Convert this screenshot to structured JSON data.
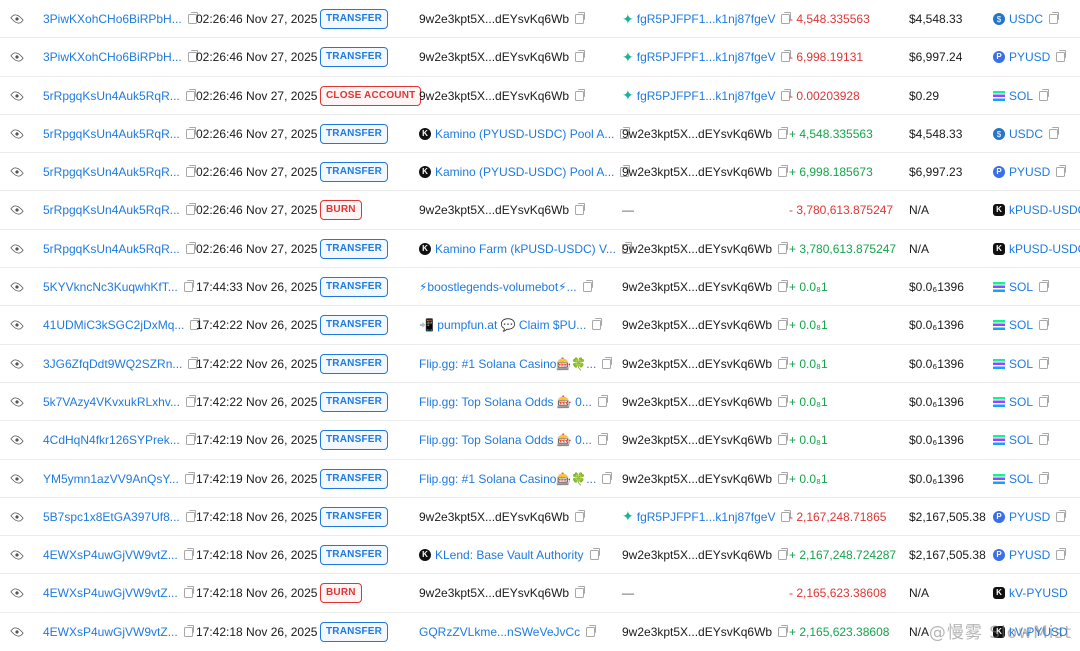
{
  "rows": [
    {
      "signature": "3PiwKXohCHo6BiRPbH...",
      "time": "02:26:46 Nov 27, 2025",
      "type": "TRANSFER",
      "from": {
        "text": "9w2e3kpt5X...dEYsvKq6Wb",
        "kind": "plain"
      },
      "to": {
        "text": "fgR5PJFPF1...k1nj87fgeV",
        "kind": "mint"
      },
      "amount": "- 4,548.335563",
      "sign": "neg",
      "value": "$4,548.33",
      "token": "USDC",
      "token_icon": "usdc"
    },
    {
      "signature": "3PiwKXohCHo6BiRPbH...",
      "time": "02:26:46 Nov 27, 2025",
      "type": "TRANSFER",
      "from": {
        "text": "9w2e3kpt5X...dEYsvKq6Wb",
        "kind": "plain"
      },
      "to": {
        "text": "fgR5PJFPF1...k1nj87fgeV",
        "kind": "mint"
      },
      "amount": "- 6,998.19131",
      "sign": "neg",
      "value": "$6,997.24",
      "token": "PYUSD",
      "token_icon": "pyusd"
    },
    {
      "signature": "5rRpgqKsUn4Auk5RqR...",
      "time": "02:26:46 Nov 27, 2025",
      "type": "CLOSE ACCOUNT",
      "from": {
        "text": "9w2e3kpt5X...dEYsvKq6Wb",
        "kind": "plain"
      },
      "to": {
        "text": "fgR5PJFPF1...k1nj87fgeV",
        "kind": "mint"
      },
      "amount": "- 0.00203928",
      "sign": "neg",
      "value": "$0.29",
      "token": "SOL",
      "token_icon": "sol"
    },
    {
      "signature": "5rRpgqKsUn4Auk5RqR...",
      "time": "02:26:46 Nov 27, 2025",
      "type": "TRANSFER",
      "from": {
        "text": "Kamino (PYUSD-USDC) Pool A...",
        "kind": "kamino"
      },
      "to": {
        "text": "9w2e3kpt5X...dEYsvKq6Wb",
        "kind": "plain"
      },
      "amount": "+ 4,548.335563",
      "sign": "pos",
      "value": "$4,548.33",
      "token": "USDC",
      "token_icon": "usdc"
    },
    {
      "signature": "5rRpgqKsUn4Auk5RqR...",
      "time": "02:26:46 Nov 27, 2025",
      "type": "TRANSFER",
      "from": {
        "text": "Kamino (PYUSD-USDC) Pool A...",
        "kind": "kamino"
      },
      "to": {
        "text": "9w2e3kpt5X...dEYsvKq6Wb",
        "kind": "plain"
      },
      "amount": "+ 6,998.185673",
      "sign": "pos",
      "value": "$6,997.23",
      "token": "PYUSD",
      "token_icon": "pyusd"
    },
    {
      "signature": "5rRpgqKsUn4Auk5RqR...",
      "time": "02:26:46 Nov 27, 2025",
      "type": "BURN",
      "from": {
        "text": "9w2e3kpt5X...dEYsvKq6Wb",
        "kind": "plain"
      },
      "to": {
        "text": "—",
        "kind": "none"
      },
      "amount": "- 3,780,613.875247",
      "sign": "neg",
      "value": "N/A",
      "token": "kPUSD-USDC",
      "token_icon": "kp"
    },
    {
      "signature": "5rRpgqKsUn4Auk5RqR...",
      "time": "02:26:46 Nov 27, 2025",
      "type": "TRANSFER",
      "from": {
        "text": "Kamino Farm (kPUSD-USDC) V...",
        "kind": "kamino"
      },
      "to": {
        "text": "9w2e3kpt5X...dEYsvKq6Wb",
        "kind": "plain"
      },
      "amount": "+ 3,780,613.875247",
      "sign": "pos",
      "value": "N/A",
      "token": "kPUSD-USDC",
      "token_icon": "kp"
    },
    {
      "signature": "5KYVkncNc3KuqwhKfT...",
      "time": "17:44:33 Nov 26, 2025",
      "type": "TRANSFER",
      "from": {
        "text": "⚡boostlegends-volumebot⚡...",
        "kind": "link"
      },
      "to": {
        "text": "9w2e3kpt5X...dEYsvKq6Wb",
        "kind": "plain"
      },
      "amount": "+ 0.0₈1",
      "sign": "pos",
      "value": "$0.0₆1396",
      "token": "SOL",
      "token_icon": "sol"
    },
    {
      "signature": "41UDMiC3kSGC2jDxMq...",
      "time": "17:42:22 Nov 26, 2025",
      "type": "TRANSFER",
      "from": {
        "text": "📲 pumpfun.at 💬 Claim $PU...",
        "kind": "link"
      },
      "to": {
        "text": "9w2e3kpt5X...dEYsvKq6Wb",
        "kind": "plain"
      },
      "amount": "+ 0.0₈1",
      "sign": "pos",
      "value": "$0.0₆1396",
      "token": "SOL",
      "token_icon": "sol"
    },
    {
      "signature": "3JG6ZfqDdt9WQ2SZRn...",
      "time": "17:42:22 Nov 26, 2025",
      "type": "TRANSFER",
      "from": {
        "text": "Flip.gg: #1 Solana Casino🎰🍀...",
        "kind": "link"
      },
      "to": {
        "text": "9w2e3kpt5X...dEYsvKq6Wb",
        "kind": "plain"
      },
      "amount": "+ 0.0₈1",
      "sign": "pos",
      "value": "$0.0₆1396",
      "token": "SOL",
      "token_icon": "sol"
    },
    {
      "signature": "5k7VAzy4VKvxukRLxhv...",
      "time": "17:42:22 Nov 26, 2025",
      "type": "TRANSFER",
      "from": {
        "text": "Flip.gg: Top Solana Odds 🎰 0...",
        "kind": "link"
      },
      "to": {
        "text": "9w2e3kpt5X...dEYsvKq6Wb",
        "kind": "plain"
      },
      "amount": "+ 0.0₈1",
      "sign": "pos",
      "value": "$0.0₆1396",
      "token": "SOL",
      "token_icon": "sol"
    },
    {
      "signature": "4CdHqN4fkr126SYPrek...",
      "time": "17:42:19 Nov 26, 2025",
      "type": "TRANSFER",
      "from": {
        "text": "Flip.gg: Top Solana Odds 🎰 0...",
        "kind": "link"
      },
      "to": {
        "text": "9w2e3kpt5X...dEYsvKq6Wb",
        "kind": "plain"
      },
      "amount": "+ 0.0₈1",
      "sign": "pos",
      "value": "$0.0₆1396",
      "token": "SOL",
      "token_icon": "sol"
    },
    {
      "signature": "YM5ymn1azVV9AnQsY...",
      "time": "17:42:19 Nov 26, 2025",
      "type": "TRANSFER",
      "from": {
        "text": "Flip.gg: #1 Solana Casino🎰🍀...",
        "kind": "link"
      },
      "to": {
        "text": "9w2e3kpt5X...dEYsvKq6Wb",
        "kind": "plain"
      },
      "amount": "+ 0.0₈1",
      "sign": "pos",
      "value": "$0.0₆1396",
      "token": "SOL",
      "token_icon": "sol"
    },
    {
      "signature": "5B7spc1x8EtGA397Uf8...",
      "time": "17:42:18 Nov 26, 2025",
      "type": "TRANSFER",
      "from": {
        "text": "9w2e3kpt5X...dEYsvKq6Wb",
        "kind": "plain"
      },
      "to": {
        "text": "fgR5PJFPF1...k1nj87fgeV",
        "kind": "mint"
      },
      "amount": "- 2,167,248.71865",
      "sign": "neg",
      "value": "$2,167,505.38",
      "token": "PYUSD",
      "token_icon": "pyusd"
    },
    {
      "signature": "4EWXsP4uwGjVW9vtZ...",
      "time": "17:42:18 Nov 26, 2025",
      "type": "TRANSFER",
      "from": {
        "text": "KLend: Base Vault Authority",
        "kind": "kamino"
      },
      "to": {
        "text": "9w2e3kpt5X...dEYsvKq6Wb",
        "kind": "plain"
      },
      "amount": "+ 2,167,248.724287",
      "sign": "pos",
      "value": "$2,167,505.38",
      "token": "PYUSD",
      "token_icon": "pyusd"
    },
    {
      "signature": "4EWXsP4uwGjVW9vtZ...",
      "time": "17:42:18 Nov 26, 2025",
      "type": "BURN",
      "from": {
        "text": "9w2e3kpt5X...dEYsvKq6Wb",
        "kind": "plain"
      },
      "to": {
        "text": "—",
        "kind": "none"
      },
      "amount": "- 2,165,623.38608",
      "sign": "neg",
      "value": "N/A",
      "token": "kV-PYUSD",
      "token_icon": "kv"
    },
    {
      "signature": "4EWXsP4uwGjVW9vtZ...",
      "time": "17:42:18 Nov 26, 2025",
      "type": "TRANSFER",
      "from": {
        "text": "GQRzZVLkme...nSWeVeJvCc",
        "kind": "link"
      },
      "to": {
        "text": "9w2e3kpt5X...dEYsvKq6Wb",
        "kind": "plain"
      },
      "amount": "+ 2,165,623.38608",
      "sign": "pos",
      "value": "N/A",
      "token": "kV-PYUSD",
      "token_icon": "kv"
    }
  ],
  "watermark": "@慢雾 SlowMist"
}
